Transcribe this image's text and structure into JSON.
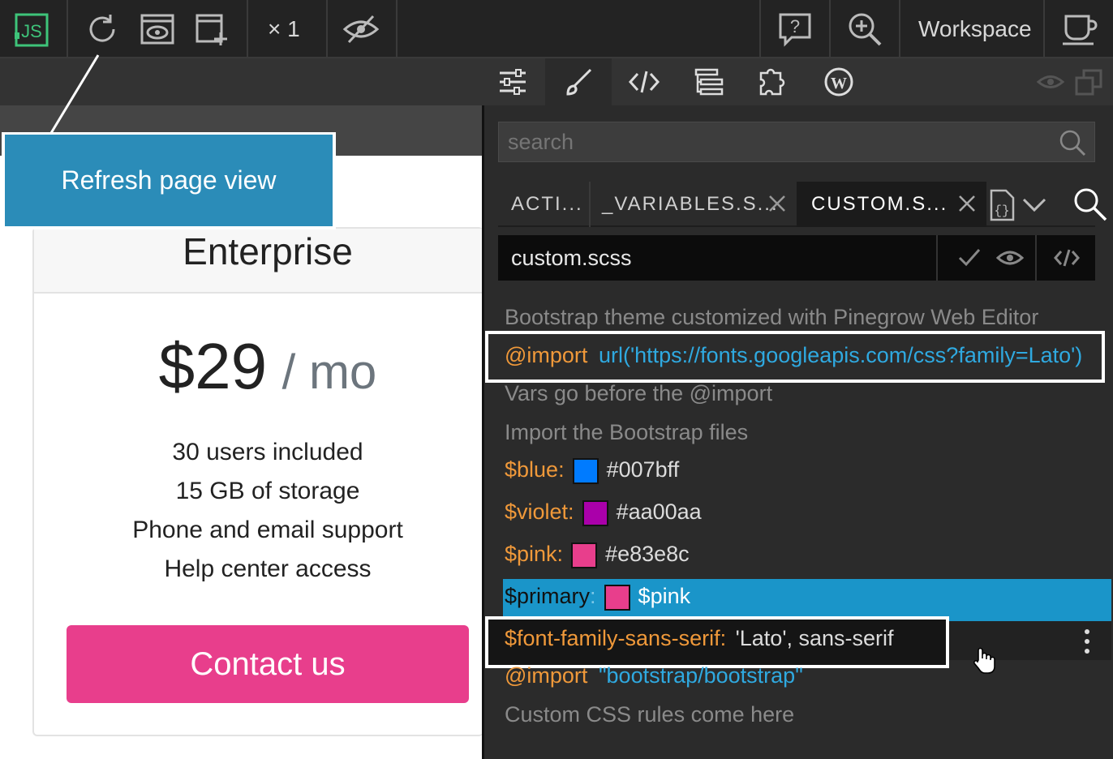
{
  "toolbar": {
    "zoom_label": "× 1",
    "workspace_label": "Workspace"
  },
  "callout": {
    "text": "Refresh page view"
  },
  "pricing_card": {
    "title": "Enterprise",
    "price": "$29",
    "period": "/ mo",
    "features": [
      "30 users included",
      "15 GB of storage",
      "Phone and email support",
      "Help center access"
    ],
    "button_label": "Contact us",
    "button_color": "#e83e8c"
  },
  "editor": {
    "search_placeholder": "search",
    "tabs": [
      {
        "label": "ACTI..."
      },
      {
        "label": "_VARIABLES.S..."
      },
      {
        "label": "CUSTOM.S..."
      }
    ],
    "file_name": "custom.scss",
    "lines": {
      "comment1": "Bootstrap theme customized with Pinegrow Web Editor",
      "import1_keyword": "@import",
      "import1_value": "url('https://fonts.googleapis.com/css?family=Lato')",
      "comment2": "Vars go before the @import",
      "comment3": "Import the Bootstrap files",
      "blue_var": "$blue",
      "blue_value": "#007bff",
      "violet_var": "$violet",
      "violet_value": "#aa00aa",
      "pink_var": "$pink",
      "pink_value": "#e83e8c",
      "primary_var": "$primary",
      "primary_value": "$pink",
      "font_var": "$font-family-sans-serif",
      "font_value": "'Lato', sans-serif",
      "import2_keyword": "@import",
      "import2_value": "\"bootstrap/bootstrap\"",
      "comment4": "Custom CSS rules come here",
      "colon": ":"
    },
    "swatch_colors": {
      "blue": "#007bff",
      "violet": "#aa00aa",
      "pink": "#e83e8c"
    },
    "highlight_color": "#1a95c9"
  }
}
